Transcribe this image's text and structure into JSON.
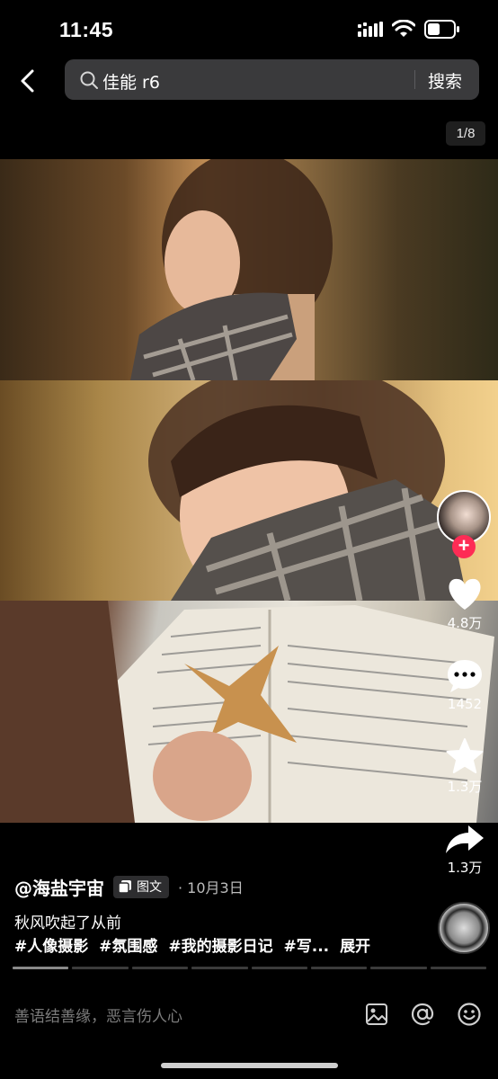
{
  "status_bar": {
    "time": "11:45"
  },
  "search": {
    "query": "佳能 r6",
    "button_label": "搜索"
  },
  "gallery": {
    "page_counter": "1/8",
    "current_page": 1,
    "total_pages": 8
  },
  "actions": {
    "likes": "4.8万",
    "comments": "1452",
    "favorites": "1.3万",
    "shares": "1.3万"
  },
  "post": {
    "author": "@海盐宇宙",
    "type_badge": "图文",
    "date": "· 10月3日",
    "caption": "秋风吹起了从前",
    "hashtags": [
      "#人像摄影",
      "#氛围感",
      "#我的摄影日记",
      "#写..."
    ],
    "expand_label": "展开"
  },
  "comment_bar": {
    "placeholder": "善语结善缘，恶言伤人心"
  },
  "colors": {
    "accent": "#fe2c55",
    "background": "#000000",
    "search_bg": "#3a3a3c"
  }
}
